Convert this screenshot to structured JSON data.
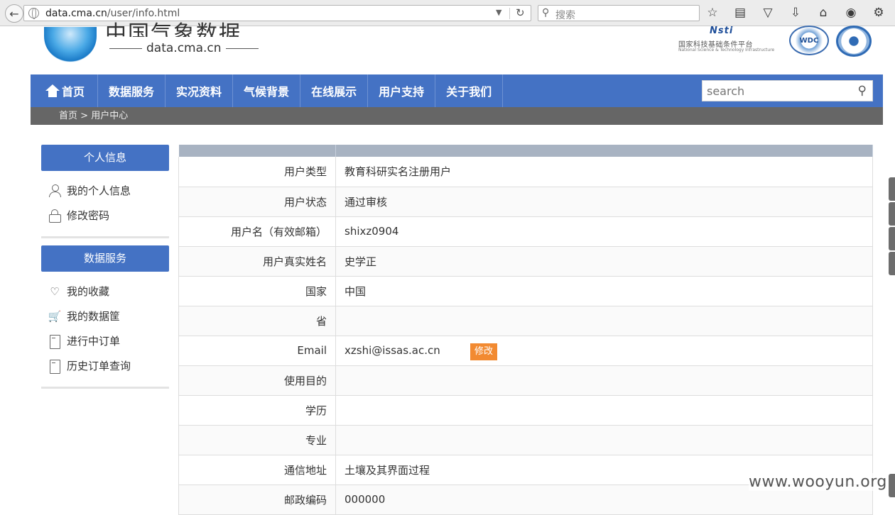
{
  "browser": {
    "url_host": "data.cma.cn",
    "url_path": "/user/info.html",
    "search_placeholder": "搜索"
  },
  "header": {
    "logo_cn": "中国气象数据网",
    "logo_en": "data.cma.cn",
    "partner_logo": "Nsti",
    "partner_cn": "国家科技基础条件平台",
    "partner_en": "National Science & Technology Infrastructure",
    "wdc_logo": "WDC"
  },
  "nav": {
    "items": [
      "首页",
      "数据服务",
      "实况资料",
      "气候背景",
      "在线展示",
      "用户支持",
      "关于我们"
    ],
    "search_placeholder": "search"
  },
  "breadcrumb": {
    "home": "首页",
    "sep": ">",
    "current": "用户中心"
  },
  "sidebar": {
    "personal": {
      "title": "个人信息",
      "items": [
        "我的个人信息",
        "修改密码"
      ]
    },
    "data_service": {
      "title": "数据服务",
      "items": [
        "我的收藏",
        "我的数据筐",
        "进行中订单",
        "历史订单查询"
      ]
    }
  },
  "profile": {
    "rows": [
      {
        "label": "用户类型",
        "value": "教育科研实名注册用户"
      },
      {
        "label": "用户状态",
        "value": "通过审核"
      },
      {
        "label": "用户名（有效邮箱）",
        "value": "shixz0904"
      },
      {
        "label": "用户真实姓名",
        "value": "史学正"
      },
      {
        "label": "国家",
        "value": "中国"
      },
      {
        "label": "省",
        "value": ""
      },
      {
        "label": "Email",
        "value": "xzshi@issas.ac.cn"
      },
      {
        "label": "使用目的",
        "value": ""
      },
      {
        "label": "学历",
        "value": ""
      },
      {
        "label": "专业",
        "value": ""
      },
      {
        "label": "通信地址",
        "value": "土壤及其界面过程"
      },
      {
        "label": "邮政编码",
        "value": "000000"
      }
    ],
    "edit_label": "修改"
  },
  "watermark": "www.wooyun.org"
}
